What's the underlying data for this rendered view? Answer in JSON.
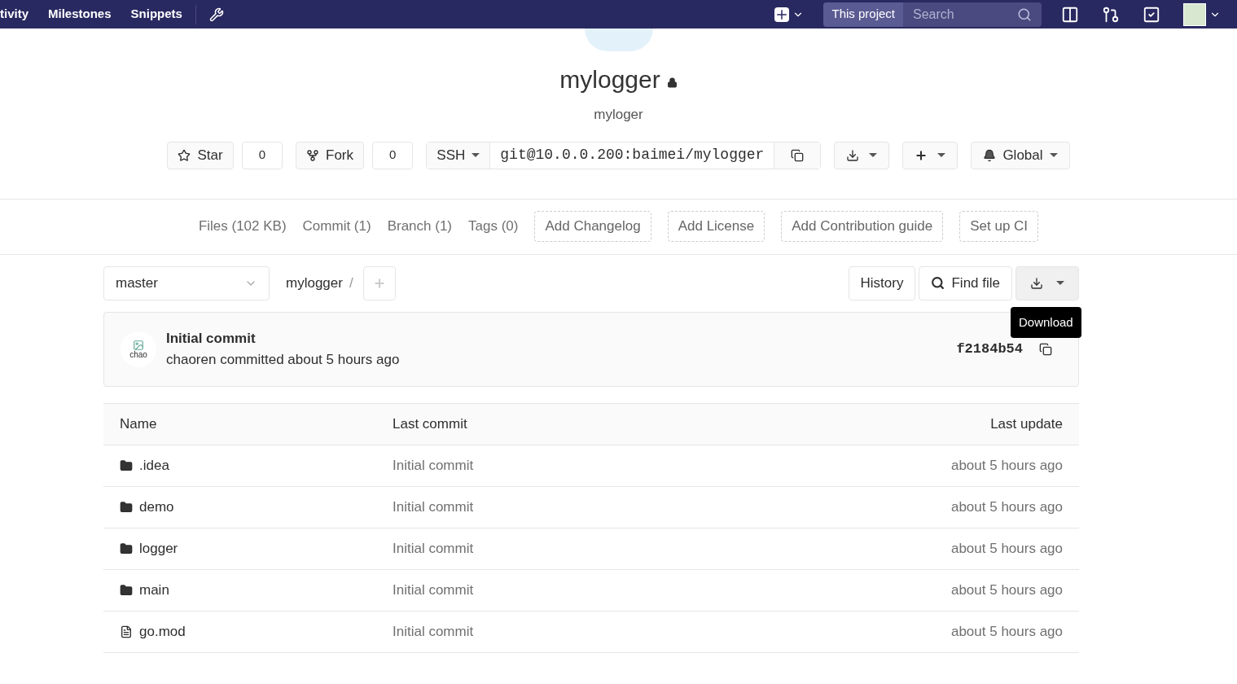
{
  "navbar": {
    "links": [
      "tivity",
      "Milestones",
      "Snippets"
    ],
    "scope": "This project",
    "search": {
      "placeholder": "Search"
    }
  },
  "project": {
    "name": "mylogger",
    "private": true,
    "description": "myloger"
  },
  "actions": {
    "star": {
      "label": "Star",
      "count": "0"
    },
    "fork": {
      "label": "Fork",
      "count": "0"
    },
    "protocol": "SSH",
    "clone_url": "git@10.0.0.200:baimei/mylogger",
    "notification": "Global"
  },
  "stats": [
    {
      "kind": "link",
      "label": "Files (102 KB)"
    },
    {
      "kind": "link",
      "label": "Commit (1)"
    },
    {
      "kind": "link",
      "label": "Branch (1)"
    },
    {
      "kind": "link",
      "label": "Tags (0)"
    },
    {
      "kind": "add",
      "label": "Add Changelog"
    },
    {
      "kind": "add",
      "label": "Add License"
    },
    {
      "kind": "add",
      "label": "Add Contribution guide"
    },
    {
      "kind": "add",
      "label": "Set up CI"
    }
  ],
  "tree_bar": {
    "branch": "master",
    "path": "mylogger",
    "separator": "/",
    "history": "History",
    "find_file": "Find file",
    "tooltip": "Download"
  },
  "commit": {
    "avatar_alt": "chao",
    "title": "Initial commit",
    "author": "chaoren",
    "meta": "committed about 5 hours ago",
    "sha": "f2184b54"
  },
  "table": {
    "columns": [
      "Name",
      "Last commit",
      "Last update"
    ],
    "rows": [
      {
        "kind": "folder",
        "name": ".idea",
        "last_commit": "Initial commit",
        "last_update": "about 5 hours ago"
      },
      {
        "kind": "folder",
        "name": "demo",
        "last_commit": "Initial commit",
        "last_update": "about 5 hours ago"
      },
      {
        "kind": "folder",
        "name": "logger",
        "last_commit": "Initial commit",
        "last_update": "about 5 hours ago"
      },
      {
        "kind": "folder",
        "name": "main",
        "last_commit": "Initial commit",
        "last_update": "about 5 hours ago"
      },
      {
        "kind": "file",
        "name": "go.mod",
        "last_commit": "Initial commit",
        "last_update": "about 5 hours ago"
      }
    ]
  }
}
